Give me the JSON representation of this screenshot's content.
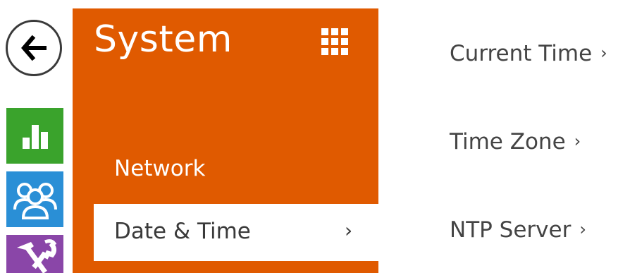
{
  "icons": {
    "back": "arrow-left-icon",
    "stats": "bar-chart-icon",
    "users": "users-icon",
    "tools": "tools-icon",
    "grid": "grid-icon"
  },
  "colors": {
    "system_orange": "#e05a00",
    "stats_green": "#3aa32c",
    "users_blue": "#2a8fd6",
    "tools_purple": "#8a46a8"
  },
  "system": {
    "title": "System",
    "menu": {
      "network": "Network",
      "date_time": "Date & Time",
      "chevron": "›"
    }
  },
  "links": {
    "current_time": "Current Time",
    "time_zone": "Time Zone",
    "ntp_server": "NTP Server",
    "chevron": "›"
  }
}
